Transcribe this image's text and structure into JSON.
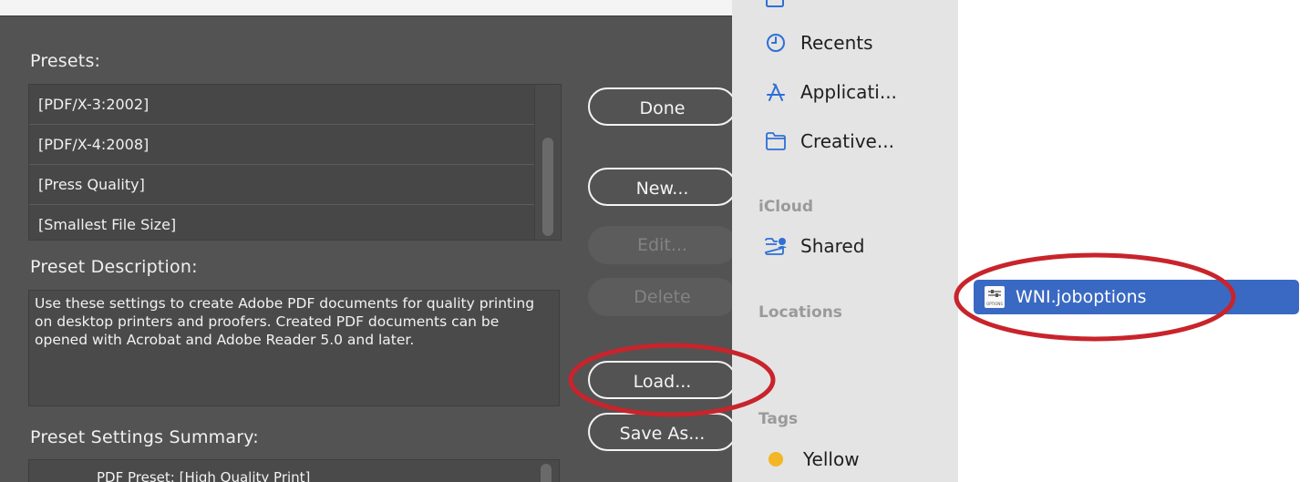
{
  "presets": {
    "label": "Presets:",
    "items": [
      "[PDF/X-3:2002]",
      "[PDF/X-4:2008]",
      "[Press Quality]",
      "[Smallest File Size]"
    ]
  },
  "description": {
    "label": "Preset Description:",
    "text": "Use these settings to create Adobe PDF documents for quality printing on desktop printers and proofers. Created PDF documents can be opened with Acrobat and Adobe Reader 5.0 and later."
  },
  "summary": {
    "label": "Preset Settings Summary:",
    "first_line": "PDF Preset: [High Quality Print]"
  },
  "buttons": {
    "done": "Done",
    "new": "New...",
    "edit": "Edit...",
    "delete": "Delete",
    "load": "Load...",
    "save_as": "Save As..."
  },
  "sidebar": {
    "recents": "Recents",
    "applications": "Applicati...",
    "creative": "Creative...",
    "icloud_heading": "iCloud",
    "shared": "Shared",
    "locations_heading": "Locations",
    "tags_heading": "Tags",
    "tag_yellow": "Yellow"
  },
  "file": {
    "name": "WNI.joboptions",
    "icon_caption": "OPTIONS"
  },
  "colors": {
    "dialog_bg": "#535353",
    "selection_blue": "#3a69c3",
    "annotation_red": "#c8242b",
    "tag_yellow": "#f3b624",
    "finder_blue": "#2f6fd6"
  }
}
